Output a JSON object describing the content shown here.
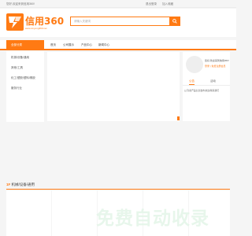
{
  "topbar": {
    "welcome": "您好,欢迎来到信用360!",
    "links": [
      "退出登录",
      "加入收藏"
    ]
  },
  "logo": {
    "name": "信用360",
    "domain": "www.xinyong360.net",
    "brand_color": "#ff7a13"
  },
  "search": {
    "placeholder": "请输入关键词"
  },
  "nav": {
    "category_label": "全部分类",
    "items": [
      "首页",
      "公司展示",
      "产品中心",
      "新闻中心"
    ]
  },
  "sidebar": {
    "items": [
      "机械/设备/通用",
      "其他/工具",
      "化工/塑胶/塑料/橡胶",
      "服务行业"
    ]
  },
  "user_panel": {
    "greeting": "您好,欢迎来到信用360!",
    "login_text": "登录 | 免费注册会员",
    "tabs": [
      "公告",
      "活动"
    ],
    "notice": "公司|新产品信息发布|欢迎|联系我们"
  },
  "floor": {
    "number": "1F",
    "title": "机械/设备/通用"
  },
  "watermark": "免费自动收录"
}
